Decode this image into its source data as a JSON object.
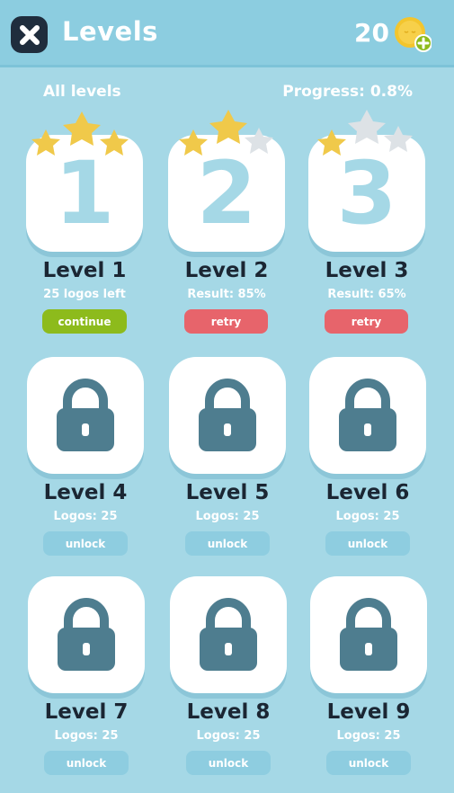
{
  "header": {
    "title": "Levels",
    "coins": "20",
    "close_icon": "close-icon",
    "coin_icon": "coin-plus-icon"
  },
  "subbar": {
    "left": "All levels",
    "right": "Progress: 0.8%"
  },
  "levels": [
    {
      "name": "Level 1",
      "number": "1",
      "sub": "25 logos left",
      "button": "continue",
      "stars": 3,
      "locked": false
    },
    {
      "name": "Level 2",
      "number": "2",
      "sub": "Result: 85%",
      "button": "retry",
      "stars": 2,
      "locked": false
    },
    {
      "name": "Level 3",
      "number": "3",
      "sub": "Result: 65%",
      "button": "retry",
      "stars": 1,
      "locked": false
    },
    {
      "name": "Level 4",
      "sub": "Logos: 25",
      "button": "unlock",
      "locked": true
    },
    {
      "name": "Level 5",
      "sub": "Logos: 25",
      "button": "unlock",
      "locked": true
    },
    {
      "name": "Level 6",
      "sub": "Logos: 25",
      "button": "unlock",
      "locked": true
    },
    {
      "name": "Level 7",
      "sub": "Logos: 25",
      "button": "unlock",
      "locked": true
    },
    {
      "name": "Level 8",
      "sub": "Logos: 25",
      "button": "unlock",
      "locked": true
    },
    {
      "name": "Level 9",
      "sub": "Logos: 25",
      "button": "unlock",
      "locked": true
    }
  ],
  "colors": {
    "background": "#a5d8e6",
    "header": "#8ccde0",
    "star_gold": "#f0c94a",
    "star_grey": "#dde2e6",
    "lock": "#4e7d8f",
    "continue": "#8dbb1c",
    "retry": "#e7646b",
    "unlock": "#8ecde0"
  }
}
